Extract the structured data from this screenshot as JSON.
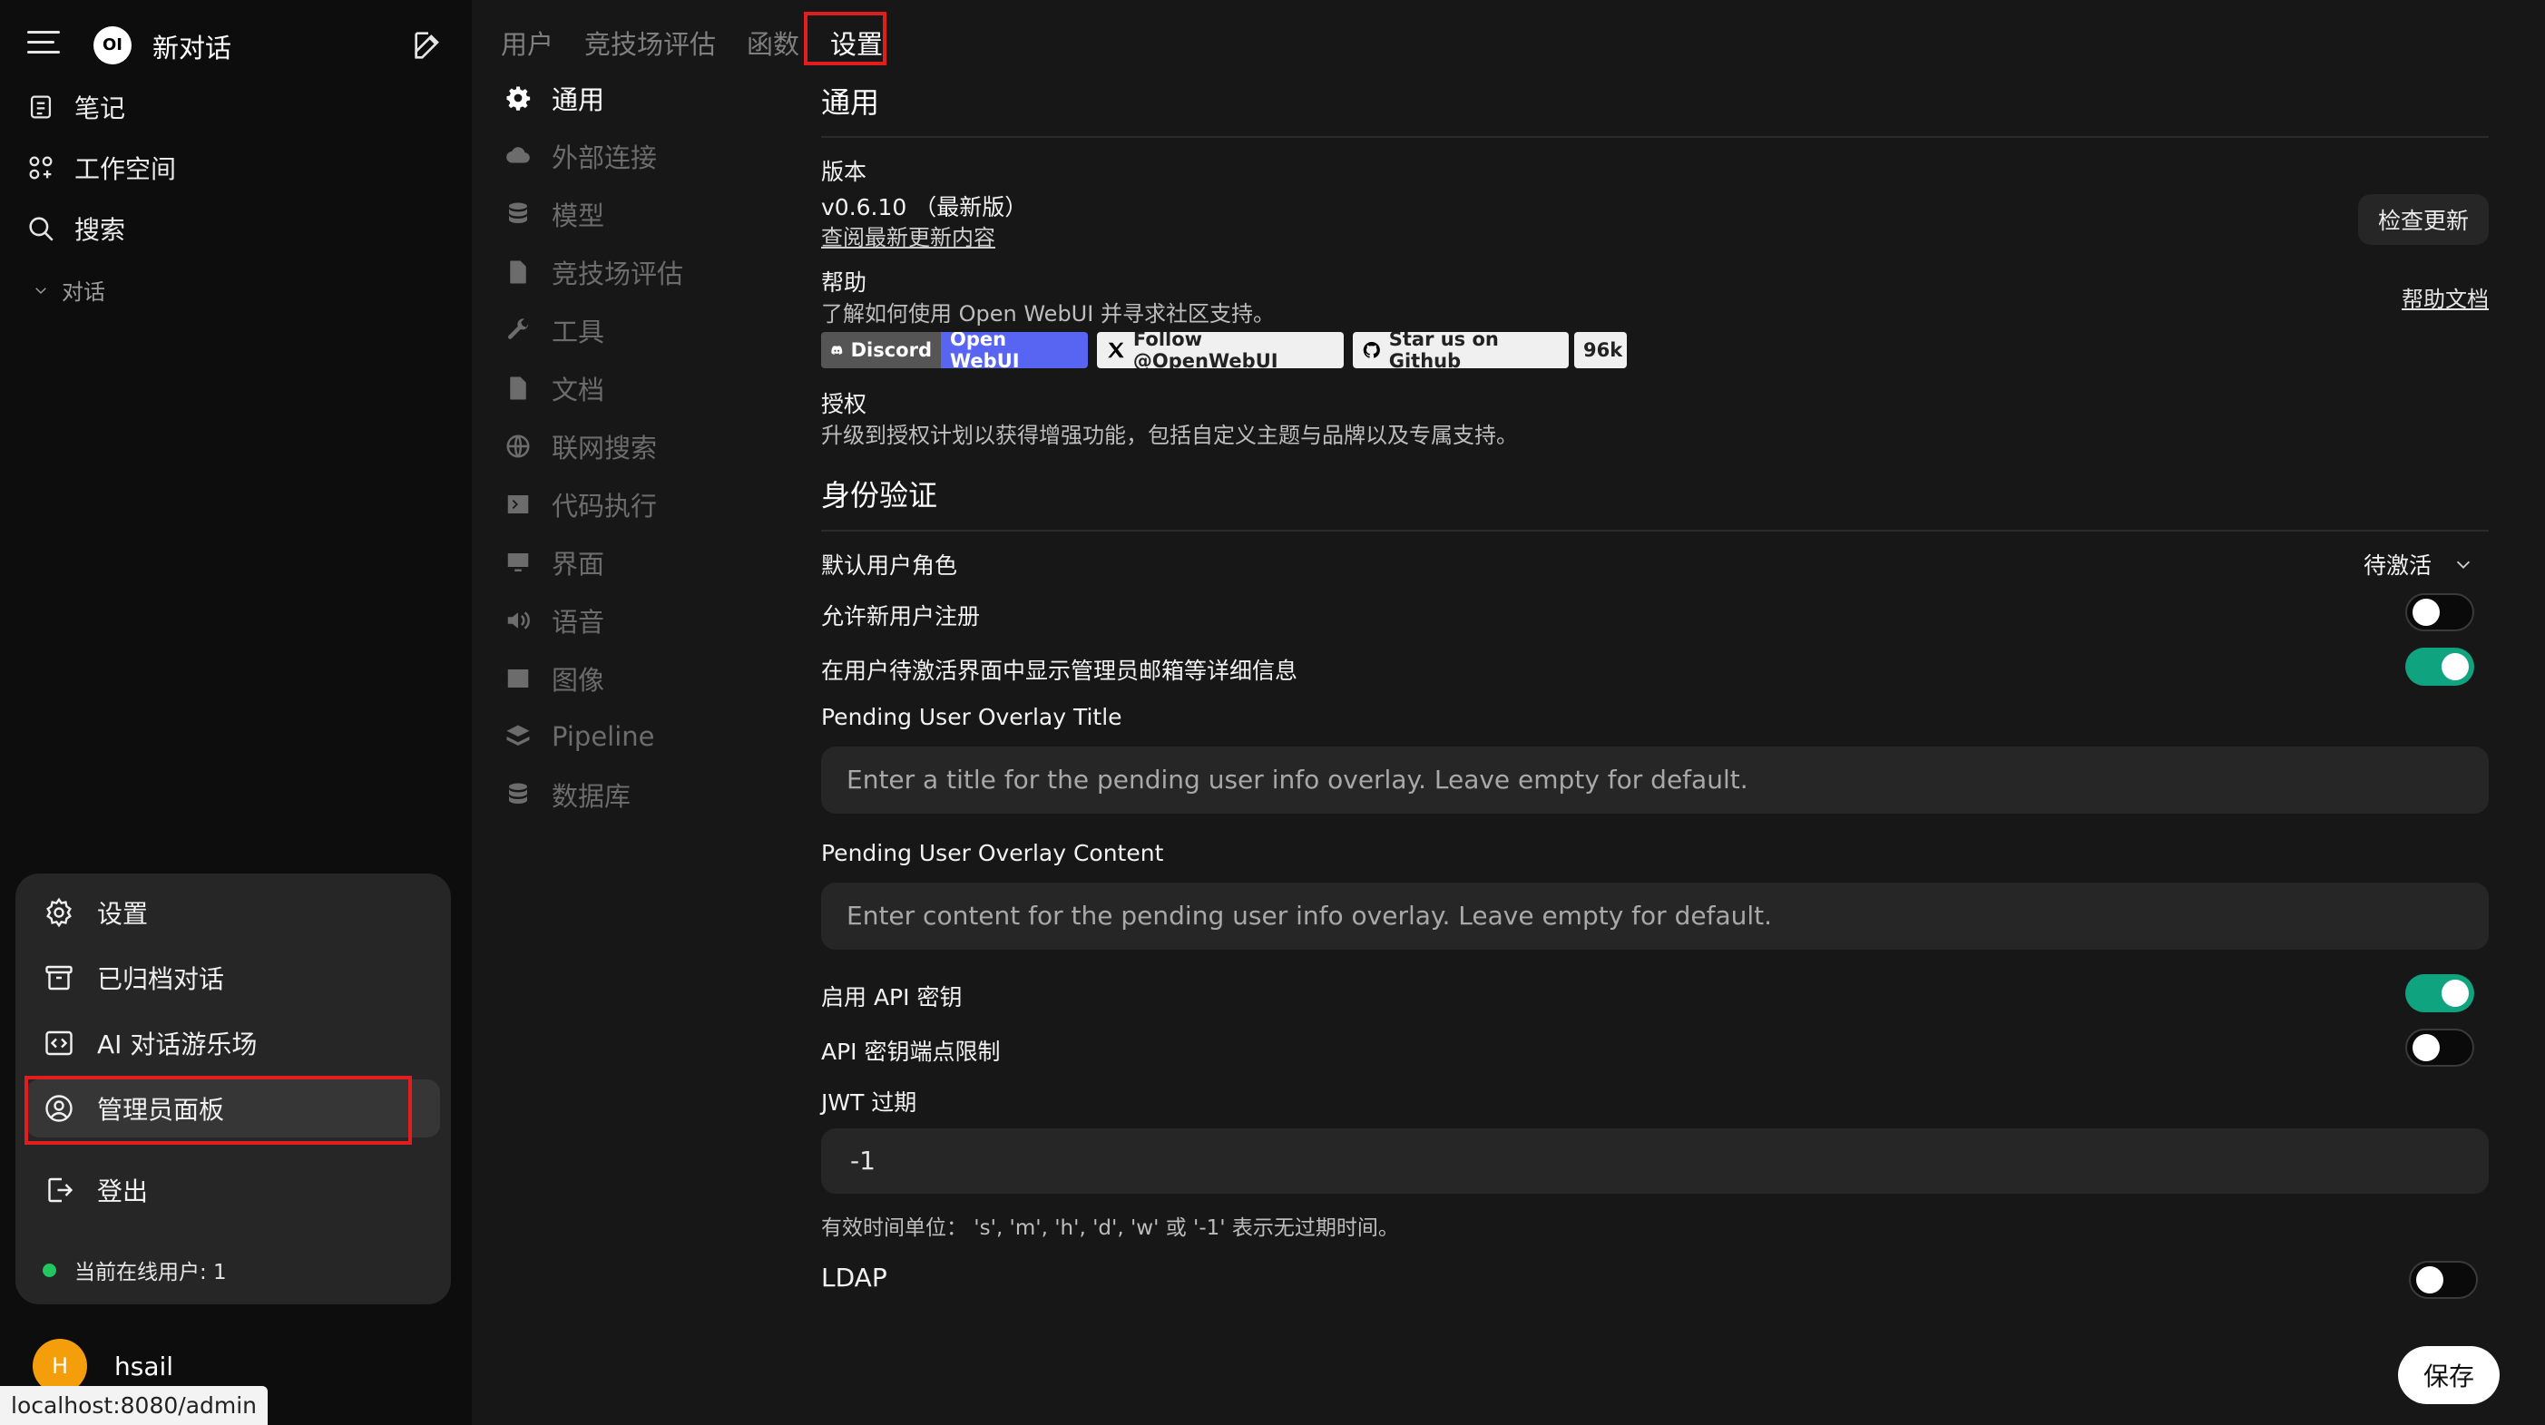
{
  "sidebar": {
    "new_chat": "新对话",
    "logo_text": "OI",
    "nav": [
      {
        "label": "笔记",
        "icon": "notes-icon"
      },
      {
        "label": "工作空间",
        "icon": "workspace-icon"
      },
      {
        "label": "搜索",
        "icon": "search-icon"
      }
    ],
    "section_label": "对话",
    "menu": [
      {
        "label": "设置",
        "icon": "gear-icon"
      },
      {
        "label": "已归档对话",
        "icon": "archive-icon"
      },
      {
        "label": "AI 对话游乐场",
        "icon": "playground-icon"
      },
      {
        "label": "管理员面板",
        "icon": "user-circle-icon"
      },
      {
        "label": "登出",
        "icon": "logout-icon"
      }
    ],
    "online_users": "当前在线用户: 1",
    "user": {
      "initial": "H",
      "name": "hsail"
    },
    "status_url": "localhost:8080/admin"
  },
  "tabs": [
    "用户",
    "竞技场评估",
    "函数",
    "设置"
  ],
  "active_tab": "设置",
  "settings_nav": [
    "通用",
    "外部连接",
    "模型",
    "竞技场评估",
    "工具",
    "文档",
    "联网搜索",
    "代码执行",
    "界面",
    "语音",
    "图像",
    "Pipeline",
    "数据库"
  ],
  "general": {
    "title": "通用",
    "version_label": "版本",
    "version_value": "v0.6.10 （最新版）",
    "changelog_link": "查阅最新更新内容",
    "check_update": "检查更新",
    "help_label": "帮助",
    "help_text": "了解如何使用 Open WebUI 并寻求社区支持。",
    "help_docs": "帮助文档",
    "badges": {
      "discord": "Discord",
      "discord_right": "Open WebUI",
      "follow": "Follow @OpenWebUI",
      "star": "Star us on Github",
      "star_count": "96k"
    },
    "license_label": "授权",
    "license_text": "升级到授权计划以获得增强功能，包括自定义主题与品牌以及专属支持。"
  },
  "auth": {
    "title": "身份验证",
    "default_role_label": "默认用户角色",
    "default_role_value": "待激活",
    "allow_signup_label": "允许新用户注册",
    "allow_signup": false,
    "show_admin_details_label": "在用户待激活界面中显示管理员邮箱等详细信息",
    "show_admin_details": true,
    "overlay_title_label": "Pending User Overlay Title",
    "overlay_title_placeholder": "Enter a title for the pending user info overlay. Leave empty for default.",
    "overlay_content_label": "Pending User Overlay Content",
    "overlay_content_placeholder": "Enter content for the pending user info overlay. Leave empty for default.",
    "api_key_label": "启用 API 密钥",
    "api_key": true,
    "api_endpoint_label": "API 密钥端点限制",
    "api_endpoint": false,
    "jwt_label": "JWT 过期",
    "jwt_value": "-1",
    "jwt_hint": "有效时间单位：  's', 'm', 'h', 'd', 'w' 或 '-1' 表示无过期时间。",
    "ldap_label": "LDAP",
    "ldap": false
  },
  "save_label": "保存",
  "colors": {
    "toggle_on": "#10a37f",
    "highlight_border": "#e11d1d",
    "online_dot": "#22c55e",
    "avatar": "#f59e0b",
    "discord": "#5865f2"
  }
}
